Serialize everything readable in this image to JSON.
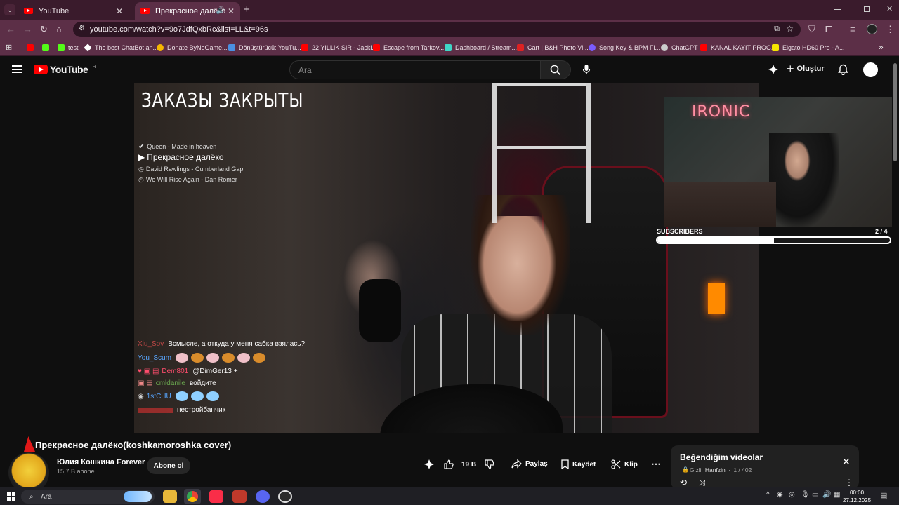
{
  "browser": {
    "tabs": [
      {
        "title": "YouTube",
        "active": false
      },
      {
        "title": "Прекрасное далёко(koshk",
        "active": true
      }
    ],
    "new_tab": "+",
    "url": "youtube.com/watch?v=9o7JdfQxbRc&list=LL&t=96s",
    "bookmarks": [
      {
        "label": "",
        "color": "#ff0000"
      },
      {
        "label": "",
        "color": "#53fc18"
      },
      {
        "label": "test",
        "color": "#53fc18"
      },
      {
        "label": "The best ChatBot an...",
        "color": "#ffffff"
      },
      {
        "label": "Donate ByNoGame...",
        "color": "#f5b700"
      },
      {
        "label": "Dönüştürücü: YouTu...",
        "color": "#4a90e2"
      },
      {
        "label": "22 YILLIK SIR - Jacki...",
        "color": "#ff0000"
      },
      {
        "label": "Escape from Tarkov...",
        "color": "#ff0000"
      },
      {
        "label": "Dashboard / Stream...",
        "color": "#3fd6c6"
      },
      {
        "label": "Cart | B&H Photo Vi...",
        "color": "#d22"
      },
      {
        "label": "Song Key & BPM Fi...",
        "color": "#7a5cff"
      },
      {
        "label": "ChatGPT",
        "color": "#cccccc"
      },
      {
        "label": "KANAL KAYIT PROG...",
        "color": "#ff0000"
      },
      {
        "label": "Elgato HD60 Pro - A...",
        "color": "#f5e400"
      }
    ],
    "bookmarks_more": "»"
  },
  "youtube": {
    "logo_text": "YouTube",
    "logo_region": "TR",
    "search_placeholder": "Ara",
    "create_label": "Oluştur"
  },
  "video_overlay": {
    "title": "ЗАКАЗЫ ЗАКРЫТЫ",
    "playlist": [
      {
        "prefix": "✔",
        "text": "Queen - Made in heaven"
      },
      {
        "prefix": "▶",
        "text": "Прекрасное далёко"
      },
      {
        "prefix": "◷",
        "text": "David Rawlings - Cumberland Gap"
      },
      {
        "prefix": "◷",
        "text": "We Will Rise Again - Dan Romer"
      }
    ],
    "chat": [
      {
        "user": "Xiu_Sov",
        "user_color": "#ff5555",
        "message": "Всмысле, а откуда у меня сабка взялась?"
      },
      {
        "user": "You_Scum",
        "user_color": "#58a6ff",
        "message": ""
      },
      {
        "user": "Dem801",
        "user_color": "#ff4d6d",
        "message": "@DimGer13 +"
      },
      {
        "user": "cmldanile",
        "user_color": "#6aa84f",
        "message": "войдите"
      },
      {
        "user": "1stCHU",
        "user_color": "#58a6ff",
        "message": ""
      },
      {
        "user": "",
        "user_color": "#ff3333",
        "message": "нестройбанчик"
      }
    ],
    "cam_neon": "IRONIC",
    "subscribers_label": "SUBSCRIBERS",
    "subscribers_count": "2 / 4",
    "subscribers_progress": 0.5
  },
  "video_info": {
    "title": "Прекрасное далёко(koshkamoroshka cover)",
    "channel": "Юлия Кошкина Forever",
    "subscribers": "15,7 B abone",
    "subscribe_label": "Abone ol",
    "likes": "19 B",
    "share": "Paylaş",
    "save": "Kaydet",
    "clip": "Klip"
  },
  "playlist_panel": {
    "title": "Beğendiğim videolar",
    "privacy": "Gizli",
    "owner": "Hanfzin",
    "position": "1 / 402"
  },
  "taskbar": {
    "search_label": "Ara",
    "time": "00:00",
    "date": "27.12.2025"
  }
}
